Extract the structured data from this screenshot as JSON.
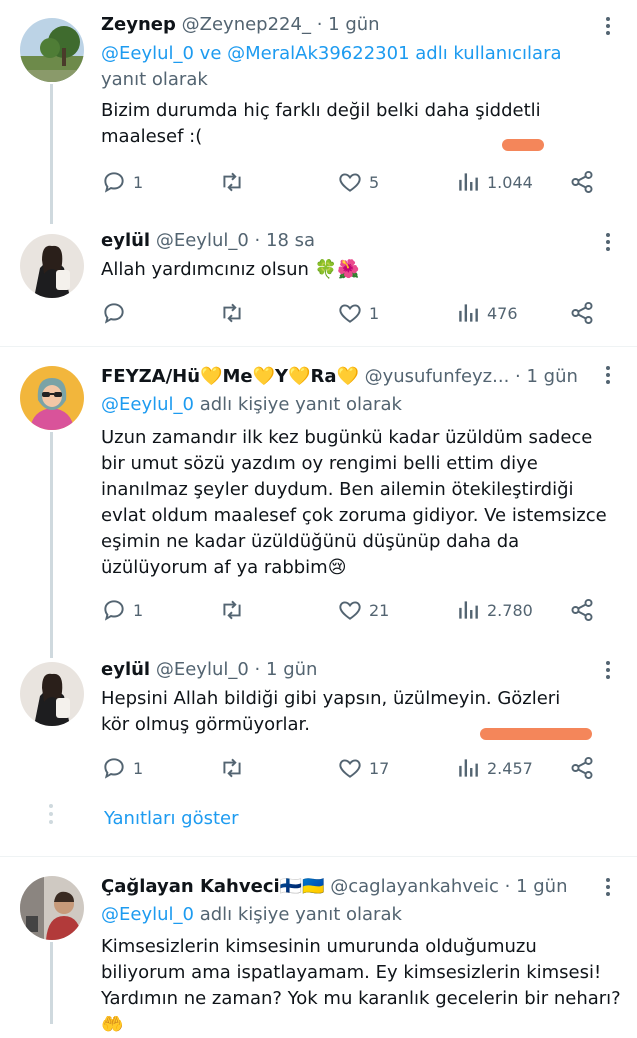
{
  "tweets": [
    {
      "name": "Zeynep",
      "handle": "@Zeynep224_",
      "time": "1 gün",
      "reply_prefix": "",
      "reply_users": "@Eeylul_0 ve @MeralAk39622301 adlı kullanıcılara",
      "reply_suffix": " yanıt olarak",
      "text": "Bizim durumda hiç farklı değil belki daha şiddetli maalesef :(",
      "replies": "1",
      "retweets": "",
      "likes": "5",
      "views": "1.044"
    },
    {
      "name": "eylül",
      "handle": "@Eeylul_0",
      "time": "18 sa",
      "text": "Allah yardımcınız olsun 🍀🌺",
      "replies": "",
      "retweets": "",
      "likes": "1",
      "views": "476"
    },
    {
      "name": "FEYZA/Hü💛Me💛Y💛Ra💛",
      "handle": "@yusufunfeyz...",
      "time": "1 gün",
      "reply_users": "@Eeylul_0",
      "reply_suffix": " adlı kişiye yanıt olarak",
      "text": "Uzun zamandır ilk kez bugünkü kadar üzüldüm sadece bir umut sözü yazdım oy rengimi belli ettim diye inanılmaz şeyler duydum. Ben ailemin ötekileştirdiği evlat oldum maalesef çok zoruma gidiyor. Ve istemsizce eşimin ne kadar üzüldüğünü düşünüp daha da üzülüyorum af ya rabbim😢",
      "replies": "1",
      "retweets": "",
      "likes": "21",
      "views": "2.780"
    },
    {
      "name": "eylül",
      "handle": "@Eeylul_0",
      "time": "1 gün",
      "text": "Hepsini Allah bildiği gibi yapsın, üzülmeyin.  Gözleri kör olmuş görmüyorlar.",
      "replies": "1",
      "retweets": "",
      "likes": "17",
      "views": "2.457"
    },
    {
      "name": "Çağlayan Kahveci🇫🇮🇺🇦",
      "handle": "@caglayankahveic",
      "time": "1 gün",
      "reply_users": "@Eeylul_0",
      "reply_suffix": " adlı kişiye yanıt olarak",
      "text": "Kimsesizlerin kimsesinin umurunda olduğumuzu biliyorum ama ispatlayamam. Ey kimsesizlerin kimsesi! Yardımın ne zaman? Yok mu karanlık gecelerin bir neharı? 🤲"
    }
  ],
  "dot": "·",
  "show_replies": "Yanıtları göster",
  "colors": {
    "link": "#1d9bf0",
    "muted": "#536471",
    "highlight": "#f4865a"
  }
}
